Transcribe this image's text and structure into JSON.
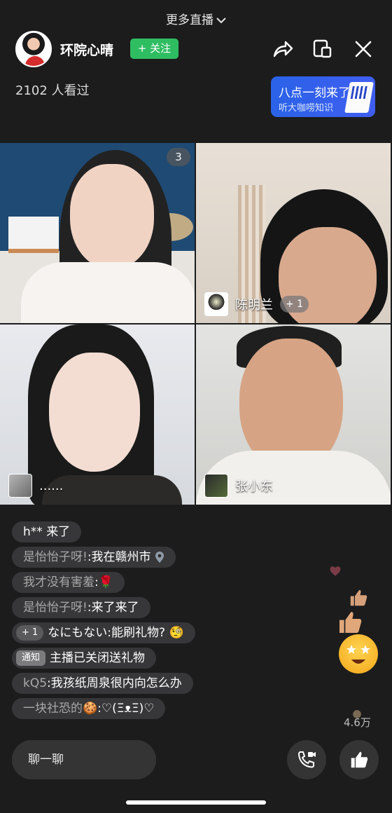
{
  "header": {
    "more_live": "更多直播",
    "host_name": "环院心晴",
    "follow_label": "+ 关注",
    "viewers": "2102 人看过"
  },
  "promo": {
    "title": "八点一刻来了",
    "subtitle": "听大咖唠知识"
  },
  "tiles": [
    {
      "badge": "3"
    },
    {
      "name": "陈明兰",
      "level": "+ 1"
    },
    {
      "name": "......"
    },
    {
      "name": "张小东"
    }
  ],
  "chat": [
    {
      "user": "h**",
      "text": "来了"
    },
    {
      "user": "是怡怡子呀!",
      "text": ":我在赣州市"
    },
    {
      "user": "我才没有害羞",
      "text": ":🌹"
    },
    {
      "user": "是怡怡子呀!",
      "text": ":来了来了"
    },
    {
      "tag": "+ 1",
      "user": "なにもない",
      "text": ":能刷礼物? 🧐"
    },
    {
      "tag": "通知",
      "text": "主播已关闭送礼物"
    },
    {
      "user": "kQ5",
      "text": ":我孩纸周泉很内向怎么办"
    },
    {
      "user": "一块社恐的🍪",
      "text": ":♡(ΞᴥΞ)♡"
    }
  ],
  "likes_count": "4.6万",
  "input_placeholder": "聊一聊",
  "colors": {
    "follow": "#2fbd62",
    "promo": "#2a62e8",
    "background": "#1c1c1d"
  }
}
